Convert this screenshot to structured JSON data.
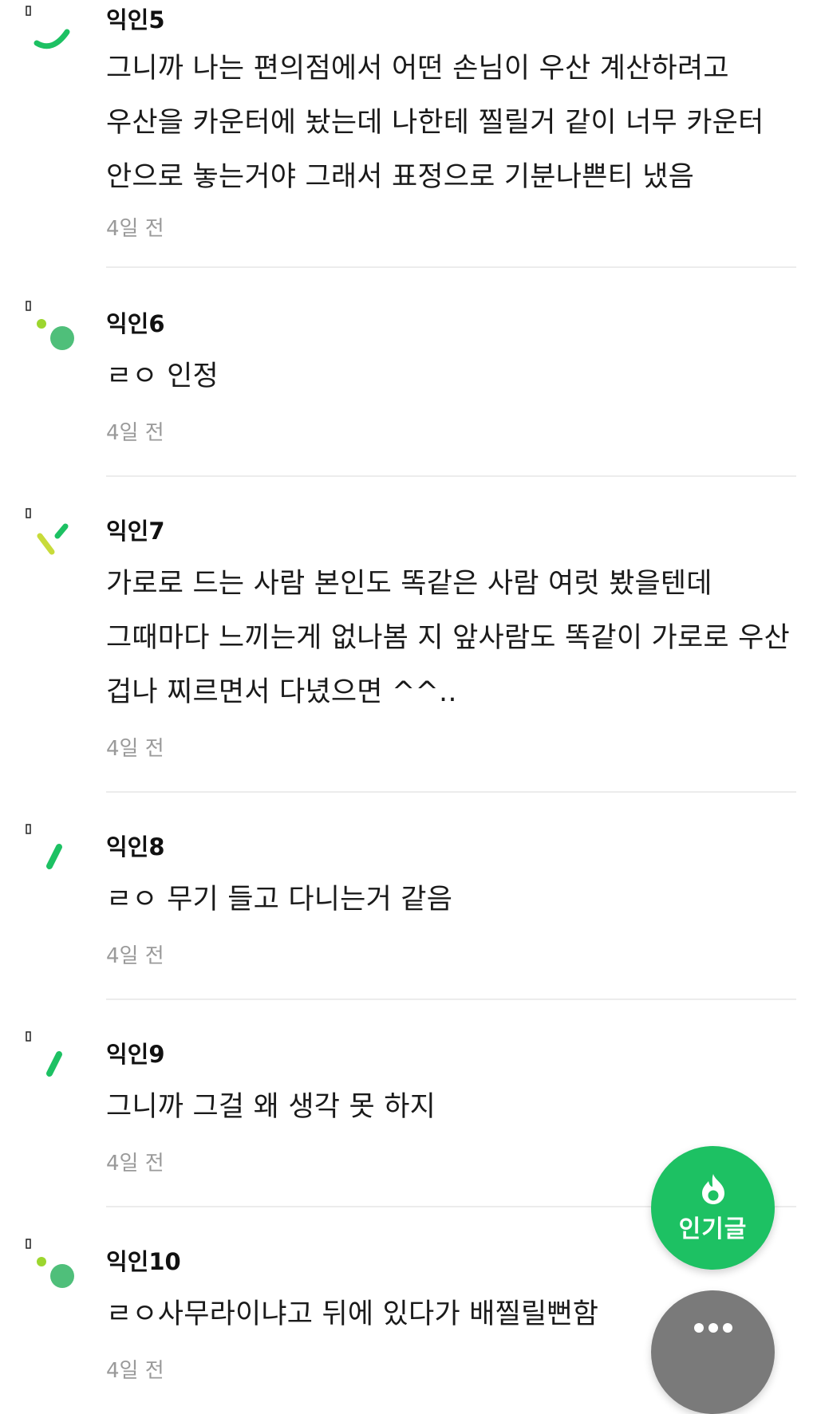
{
  "comments": [
    {
      "author": "익인5",
      "text": "그니까 나는 편의점에서 어떤 손님이 우산 계산하려고 우산을 카운터에 놨는데 나한테 찔릴거 같이 너무 카운터 안으로 놓는거야 그래서 표정으로 기분나쁜티 냈음",
      "time": "4일 전",
      "avatar": "arc-icon"
    },
    {
      "author": "익인6",
      "text": "ㄹㅇ 인정",
      "time": "4일 전",
      "avatar": "dots-icon"
    },
    {
      "author": "익인7",
      "text": "가로로 드는 사람 본인도 똑같은 사람 여럿 봤을텐데 그때마다 느끼는게 없나봄 지 앞사람도 똑같이 가로로 우산 겁나 찌르면서 다녔으면 ^^..",
      "time": "4일 전",
      "avatar": "ticks-icon"
    },
    {
      "author": "익인8",
      "text": "ㄹㅇ 무기 들고 다니는거 같음",
      "time": "4일 전",
      "avatar": "slash-icon"
    },
    {
      "author": "익인9",
      "text": "그니까 그걸 왜 생각 못 하지",
      "time": "4일 전",
      "avatar": "slash-icon"
    },
    {
      "author": "익인10",
      "text": "ㄹㅇ사무라이냐고 뒤에 있다가 배찔릴뻔함",
      "time": "4일 전",
      "avatar": "dots-icon"
    }
  ],
  "fab_hot": {
    "label": "인기글",
    "icon": "flame-icon",
    "color": "#1dc163"
  },
  "fab_more": {
    "icon": "more-dots-icon",
    "color": "#7a7a7a"
  },
  "colors": {
    "avatar_green": "#1dc163",
    "avatar_lime": "#9cd62f",
    "avatar_soft_green": "#4fbf7a",
    "time_text": "#9a9a9a"
  }
}
